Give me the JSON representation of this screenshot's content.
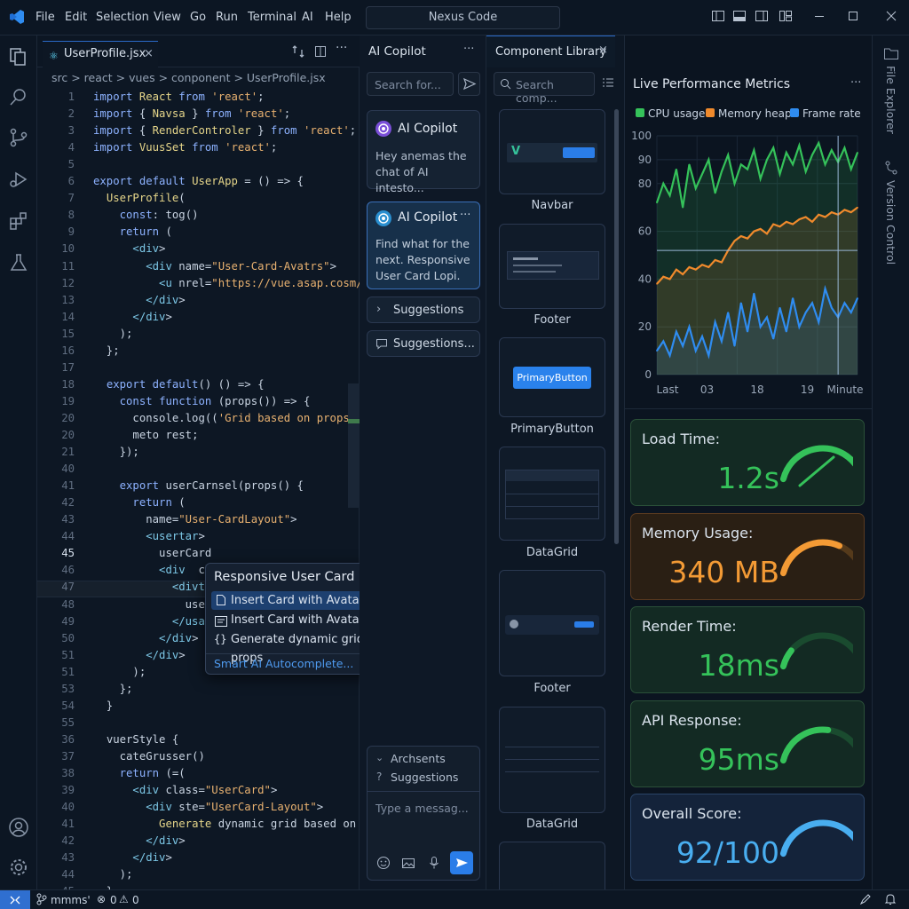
{
  "titlebar": {
    "menus": [
      "File",
      "Edit",
      "Selection",
      "View",
      "Go",
      "Run",
      "Terminal",
      "AI",
      "Help"
    ],
    "command_center": "Nexus Code"
  },
  "editor": {
    "tab_label": "UserProfile.jsx",
    "breadcrumb": "src > react > vues > conponent > UserProfile.jsx",
    "lines": [
      {
        "n": "1",
        "t": "import React from 'react';"
      },
      {
        "n": "2",
        "t": "import { Navsa } from 'react';"
      },
      {
        "n": "3",
        "t": "import { RenderControler } from 'react';"
      },
      {
        "n": "4",
        "t": "import VuusSet from 'react';"
      },
      {
        "n": "5",
        "t": ""
      },
      {
        "n": "6",
        "t": "export default UserApp = () => {"
      },
      {
        "n": "7",
        "t": "  UserProfile("
      },
      {
        "n": "8",
        "t": "    const: tog()"
      },
      {
        "n": "9",
        "t": "    return ("
      },
      {
        "n": "10",
        "t": "      <div>"
      },
      {
        "n": "11",
        "t": "        <div name=\"User-Card-Avatrs\">"
      },
      {
        "n": "12",
        "t": "          <u nrel=\"https://vue.asap.cosm/ar"
      },
      {
        "n": "13",
        "t": "        </div>"
      },
      {
        "n": "14",
        "t": "      </div>"
      },
      {
        "n": "15",
        "t": "    );"
      },
      {
        "n": "16",
        "t": "  };"
      },
      {
        "n": "17",
        "t": ""
      },
      {
        "n": "18",
        "t": "  export default() () => {"
      },
      {
        "n": "19",
        "t": "    const function (props()) => {"
      },
      {
        "n": "20",
        "t": "      console.log(('Grid based on props'), '"
      },
      {
        "n": "20",
        "t": "      meto rest;"
      },
      {
        "n": "21",
        "t": "    });"
      },
      {
        "n": "40",
        "t": ""
      },
      {
        "n": "41",
        "t": "    export userCarnsel(props() {"
      },
      {
        "n": "42",
        "t": "      return ("
      },
      {
        "n": "43",
        "t": "        name=\"User-CardLayout\">"
      },
      {
        "n": "44",
        "t": "        <usertar>"
      },
      {
        "n": "45",
        "t": "          userCard"
      },
      {
        "n": "46",
        "t": "          <div  cl"
      },
      {
        "n": "47",
        "t": "            <divte"
      },
      {
        "n": "48",
        "t": "              user"
      },
      {
        "n": "49",
        "t": "            </usat"
      },
      {
        "n": "50",
        "t": "          </div>"
      },
      {
        "n": "51",
        "t": "        </div>"
      },
      {
        "n": "51",
        "t": "      );"
      },
      {
        "n": "53",
        "t": "    };"
      },
      {
        "n": "54",
        "t": "  }"
      },
      {
        "n": "55",
        "t": ""
      },
      {
        "n": "36",
        "t": "  vuerStyle {"
      },
      {
        "n": "37",
        "t": "    cateGrusser()"
      },
      {
        "n": "38",
        "t": "    return (=("
      },
      {
        "n": "39",
        "t": "      <div class=\"UserCard\">"
      },
      {
        "n": "40",
        "t": "        <div ste=\"UserCard-Layout\">"
      },
      {
        "n": "41",
        "t": "          Generate dynamic grid based on pr"
      },
      {
        "n": "42",
        "t": "        </div>"
      },
      {
        "n": "43",
        "t": "      </div>"
      },
      {
        "n": "44",
        "t": "    );"
      },
      {
        "n": "45",
        "t": "  }"
      }
    ],
    "current_line": "45",
    "autocomplete": {
      "title": "Responsive User Card Layout",
      "items": [
        "Insert Card with Avatars",
        "Insert Card with Avatars",
        "Generate dynamic grid based on props"
      ],
      "footer": "Smart AI Autocomplete..."
    }
  },
  "copilot": {
    "panel_title": "AI Copilot",
    "search_placeholder": "Search for...",
    "cards": [
      {
        "title": "AI Copilot",
        "body": "Hey anemas the chat of AI intesto..."
      },
      {
        "title": "AI Copilot",
        "body": "Find what for the next. Responsive User Card Lopi."
      }
    ],
    "buttons": [
      "Suggestions",
      "Suggestions..."
    ],
    "bottom_items": [
      "Archsents",
      "Suggestions"
    ],
    "message_placeholder": "Type a messag..."
  },
  "library": {
    "panel_title": "Component Library",
    "search_placeholder": "Search comp...",
    "items": [
      "Navbar",
      "Footer",
      "PrimaryButton",
      "DataGrid",
      "Footer",
      "DataGrid"
    ],
    "primary_button_label": "PrimaryButton"
  },
  "metrics": {
    "title": "Live Performance Metrics",
    "legend": [
      {
        "label": "CPU usage",
        "color": "#35c25a"
      },
      {
        "label": "Memory heap",
        "color": "#f08a2c"
      },
      {
        "label": "Frame rate",
        "color": "#2f8cf0"
      }
    ],
    "cards": [
      {
        "title": "Load Time:",
        "value": "1.2s",
        "color": "#35c25a",
        "level": 0.8
      },
      {
        "title": "Memory Usage:",
        "value": "340 MB",
        "color": "#f39a35",
        "level": 0.6
      },
      {
        "title": "Render Time:",
        "value": "18ms",
        "color": "#35c25a",
        "level": 0.15
      },
      {
        "title": "API Response:",
        "value": "95ms",
        "color": "#35c25a",
        "level": 0.5
      },
      {
        "title": "Overall Score:",
        "value": "92/100",
        "color": "#49aef0",
        "level": 0.92
      }
    ]
  },
  "chart_data": {
    "type": "line",
    "title": "Live Performance Metrics",
    "x_tick_labels": [
      "Last",
      "03",
      "18",
      "19",
      "Minute"
    ],
    "y_ticks": [
      0,
      20,
      40,
      60,
      80,
      90,
      100
    ],
    "ylim": [
      0,
      100
    ],
    "grid": true,
    "legend_position": "top",
    "series": [
      {
        "name": "CPU usage",
        "color": "#35c25a",
        "values": [
          72,
          80,
          75,
          86,
          70,
          88,
          78,
          84,
          90,
          76,
          85,
          92,
          80,
          88,
          86,
          94,
          82,
          90,
          95,
          84,
          93,
          88,
          96,
          85,
          92,
          97,
          88,
          94,
          89,
          95,
          86,
          93
        ]
      },
      {
        "name": "Memory heap",
        "color": "#f08a2c",
        "values": [
          38,
          41,
          40,
          44,
          42,
          45,
          44,
          46,
          45,
          48,
          47,
          52,
          56,
          58,
          57,
          60,
          61,
          59,
          63,
          62,
          64,
          63,
          65,
          66,
          64,
          67,
          66,
          68,
          67,
          69,
          68,
          70
        ]
      },
      {
        "name": "Frame rate",
        "color": "#2f8cf0",
        "values": [
          10,
          14,
          8,
          18,
          12,
          20,
          10,
          16,
          8,
          22,
          14,
          26,
          12,
          30,
          18,
          34,
          20,
          24,
          15,
          28,
          18,
          32,
          20,
          26,
          30,
          22,
          36,
          28,
          24,
          30,
          26,
          32
        ]
      }
    ]
  },
  "statusbar": {
    "branch": "mmms'",
    "problems": "0",
    "warnings": "0"
  }
}
